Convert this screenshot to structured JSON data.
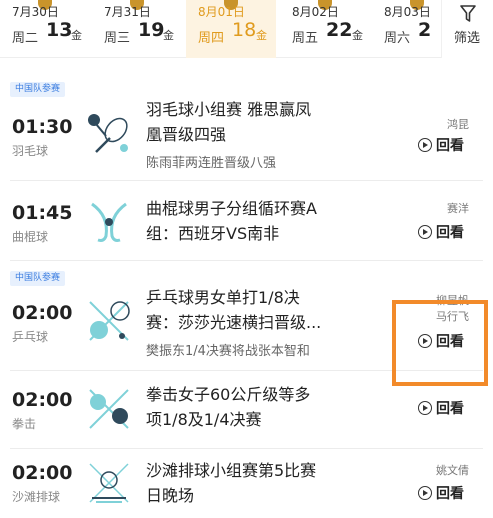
{
  "dates": [
    {
      "date": "7月30日",
      "weekday": "周二",
      "gold": "13",
      "gold_unit": "金",
      "selected": false
    },
    {
      "date": "7月31日",
      "weekday": "周三",
      "gold": "19",
      "gold_unit": "金",
      "selected": false
    },
    {
      "date": "8月01日",
      "weekday": "周四",
      "gold": "18",
      "gold_unit": "金",
      "selected": true
    },
    {
      "date": "8月02日",
      "weekday": "周五",
      "gold": "22",
      "gold_unit": "金",
      "selected": false
    },
    {
      "date": "8月03日",
      "weekday": "周六",
      "gold": "2",
      "gold_unit": "",
      "selected": false
    }
  ],
  "filter": {
    "label": "筛选",
    "icon": "filter-icon"
  },
  "colors": {
    "accent": "#e09b1e",
    "tag_bg": "#e7f0fd",
    "tag_text": "#3b7de0",
    "highlight": "#f28a2a"
  },
  "events": [
    {
      "tag": "中国队参赛",
      "time": "01:30",
      "sport": "羽毛球",
      "icon": "badminton-icon",
      "title_line1": "羽毛球小组赛 雅思赢凤",
      "title_line2": "凰晋级四强",
      "subtitle": "陈雨菲两连胜晋级八强",
      "person_line1": "鸿昆",
      "person_line2": "",
      "replay": "回看"
    },
    {
      "tag": "",
      "time": "01:45",
      "sport": "曲棍球",
      "icon": "hockey-icon",
      "title_line1": "曲棍球男子分组循环赛A",
      "title_line2": "组：西班牙VS南非",
      "subtitle": "",
      "person_line1": "赛洋",
      "person_line2": "",
      "replay": "回看"
    },
    {
      "tag": "中国队参赛",
      "time": "02:00",
      "sport": "乒乓球",
      "icon": "table-tennis-icon",
      "title_line1": "乒乓球男女单打1/8决",
      "title_line2": "赛：莎莎光速横扫晋级...",
      "subtitle": "樊振东1/4决赛将战张本智和",
      "person_line1": "柳昱帆",
      "person_line2": "马行飞",
      "replay": "回看"
    },
    {
      "tag": "",
      "time": "02:00",
      "sport": "拳击",
      "icon": "boxing-icon",
      "title_line1": "拳击女子60公斤级等多",
      "title_line2": "项1/8及1/4决赛",
      "subtitle": "",
      "person_line1": "",
      "person_line2": "",
      "replay": "回看"
    },
    {
      "tag": "",
      "time": "02:00",
      "sport": "沙滩排球",
      "icon": "beach-volleyball-icon",
      "title_line1": "沙滩排球小组赛第5比赛",
      "title_line2": "日晚场",
      "subtitle": "",
      "person_line1": "姚文倩",
      "person_line2": "",
      "replay": "回看"
    }
  ]
}
